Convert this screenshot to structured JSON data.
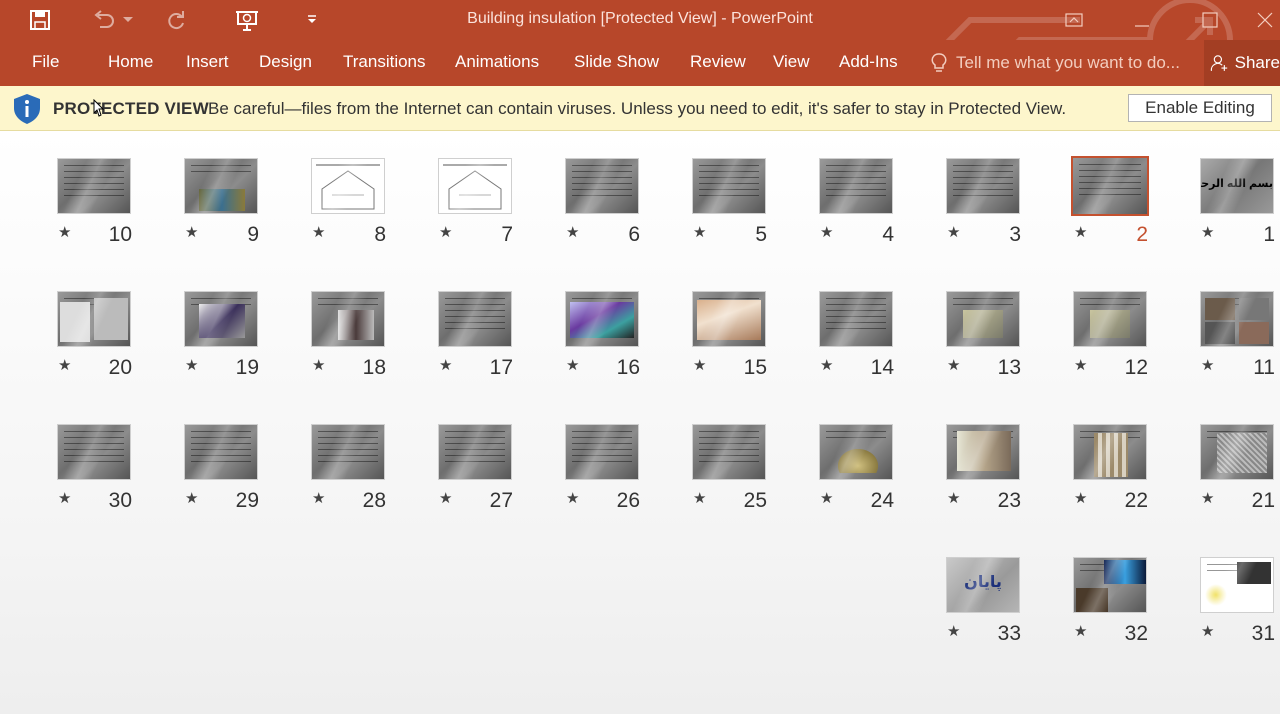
{
  "window": {
    "title": "Building insulation [Protected View] - PowerPoint",
    "accent_color": "#b7472a"
  },
  "ribbon": {
    "tabs": [
      "File",
      "Home",
      "Insert",
      "Design",
      "Transitions",
      "Animations",
      "Slide Show",
      "Review",
      "View",
      "Add-Ins"
    ],
    "tell_me": "Tell me what you want to do...",
    "share": "Share"
  },
  "protected_view": {
    "title": "PROTECTED VIEW",
    "message": "Be careful—files from the Internet can contain viruses. Unless you need to edit, it's safer to stay in Protected View.",
    "button": "Enable Editing"
  },
  "slides": {
    "selected": "2",
    "numbers": [
      "1",
      "2",
      "3",
      "4",
      "5",
      "6",
      "7",
      "8",
      "9",
      "10",
      "11",
      "12",
      "13",
      "14",
      "15",
      "16",
      "17",
      "18",
      "19",
      "20",
      "21",
      "22",
      "23",
      "24",
      "25",
      "26",
      "27",
      "28",
      "29",
      "30",
      "31",
      "32",
      "33"
    ],
    "thumb_text": {
      "s1": "بسم الله الرحمن الرحيم",
      "s33": "پايان"
    }
  }
}
